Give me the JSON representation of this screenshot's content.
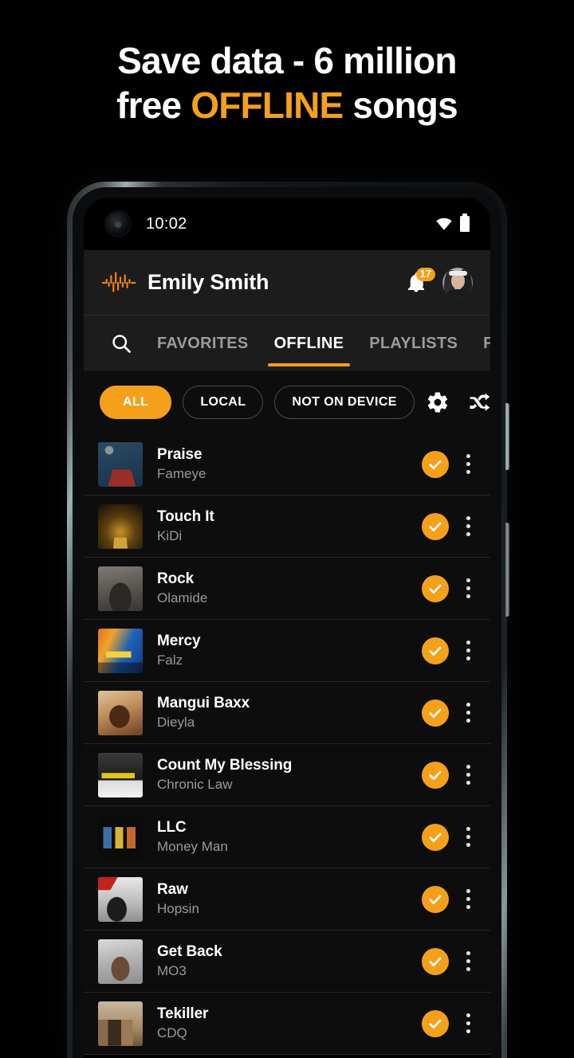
{
  "promo": {
    "line1": "Save data - 6 million",
    "line2_prefix": "free ",
    "line2_accent": "OFFLINE",
    "line2_suffix": " songs",
    "accent_color": "#F5A01B"
  },
  "status_bar": {
    "time": "10:02",
    "wifi_icon": "wifi-icon",
    "battery_icon": "battery-icon"
  },
  "header": {
    "logo_icon": "audio-waveform-logo",
    "user_name": "Emily Smith",
    "notification_icon": "bell-icon",
    "notification_count": "17",
    "avatar_label": "user-avatar"
  },
  "tabs": {
    "search_icon": "search-icon",
    "items": [
      {
        "label": "FAVORITES",
        "active": false
      },
      {
        "label": "OFFLINE",
        "active": true
      },
      {
        "label": "PLAYLISTS",
        "active": false
      },
      {
        "label": "FOLDERS",
        "active": false
      }
    ]
  },
  "filters": {
    "chips": [
      {
        "label": "ALL",
        "active": true
      },
      {
        "label": "LOCAL",
        "active": false
      },
      {
        "label": "NOT ON DEVICE",
        "active": false
      }
    ],
    "settings_icon": "gear-icon",
    "shuffle_icon": "shuffle-icon"
  },
  "songs": [
    {
      "title": "Praise",
      "artist": "Fameye",
      "downloaded": true,
      "art": "art-praise"
    },
    {
      "title": "Touch It",
      "artist": "KiDi",
      "downloaded": true,
      "art": "art-touch-it"
    },
    {
      "title": "Rock",
      "artist": "Olamide",
      "downloaded": true,
      "art": "art-rock"
    },
    {
      "title": "Mercy",
      "artist": "Falz",
      "downloaded": true,
      "art": "art-mercy"
    },
    {
      "title": "Mangui Baxx",
      "artist": "Dieyla",
      "downloaded": true,
      "art": "art-mangui-baxx"
    },
    {
      "title": "Count My Blessing",
      "artist": "Chronic Law",
      "downloaded": true,
      "art": "art-count-my-blessing"
    },
    {
      "title": "LLC",
      "artist": "Money Man",
      "downloaded": true,
      "art": "art-llc"
    },
    {
      "title": "Raw",
      "artist": "Hopsin",
      "downloaded": true,
      "art": "art-raw"
    },
    {
      "title": "Get Back",
      "artist": "MO3",
      "downloaded": true,
      "art": "art-get-back"
    },
    {
      "title": "Tekiller",
      "artist": "CDQ",
      "downloaded": true,
      "art": "art-tekiller"
    }
  ]
}
